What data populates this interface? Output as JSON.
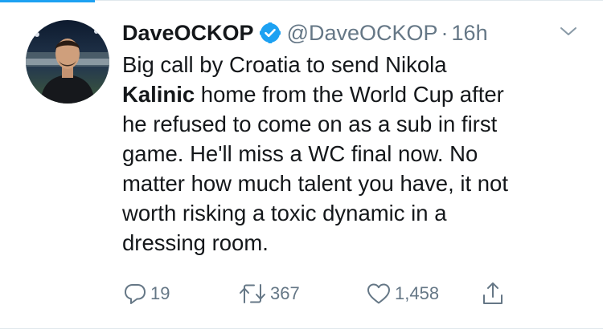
{
  "tweet": {
    "author": {
      "display_name": "DaveOCKOP",
      "handle": "@DaveOCKOP",
      "verified": true,
      "avatar": "profile-photo"
    },
    "separator": "·",
    "time": "16h",
    "text": {
      "line1": "Big call by Croatia to send Nikola",
      "line2_bold": "Kalinic",
      "line2_rest": " home from the World Cup after",
      "line3": "he refused to come on as a sub in first",
      "line4": "game. He'll miss a WC final now. No",
      "line5": "matter how much talent you have, it not",
      "line6": "worth risking a toxic dynamic in a",
      "line7": "dressing room."
    },
    "actions": {
      "reply_count": "19",
      "retweet_count": "367",
      "like_count": "1,458"
    }
  },
  "icons": {
    "verified": "verified-badge-icon",
    "caret": "chevron-down-icon",
    "reply": "reply-icon",
    "retweet": "retweet-icon",
    "like": "heart-icon",
    "share": "share-icon"
  },
  "colors": {
    "accent": "#1da1f2",
    "text": "#14171a",
    "secondary": "#657786",
    "divider": "#e1e8ed"
  }
}
